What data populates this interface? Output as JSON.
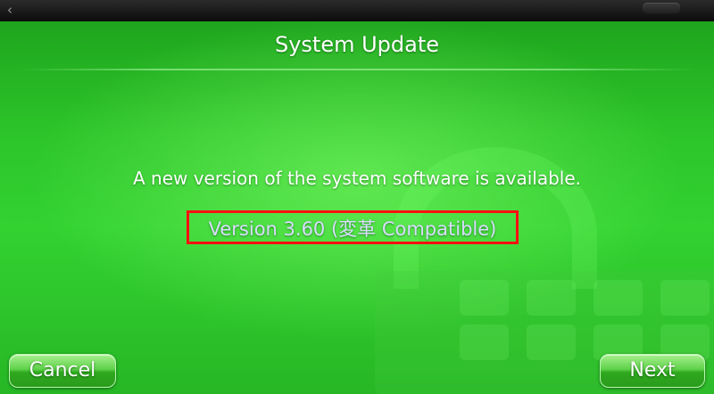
{
  "header": {
    "back_glyph": "‹"
  },
  "dialog": {
    "title": "System Update",
    "message": "A new version of the system software is available.",
    "version": "Version 3.60 (変革 Compatible)",
    "highlight_color": "#ff1010"
  },
  "buttons": {
    "cancel_label": "Cancel",
    "next_label": "Next"
  },
  "colors": {
    "background": "#2cc42a",
    "text": "#ffffff",
    "version_text": "#d8dcff"
  },
  "icons": {
    "background_watermark": "lock-icon"
  }
}
